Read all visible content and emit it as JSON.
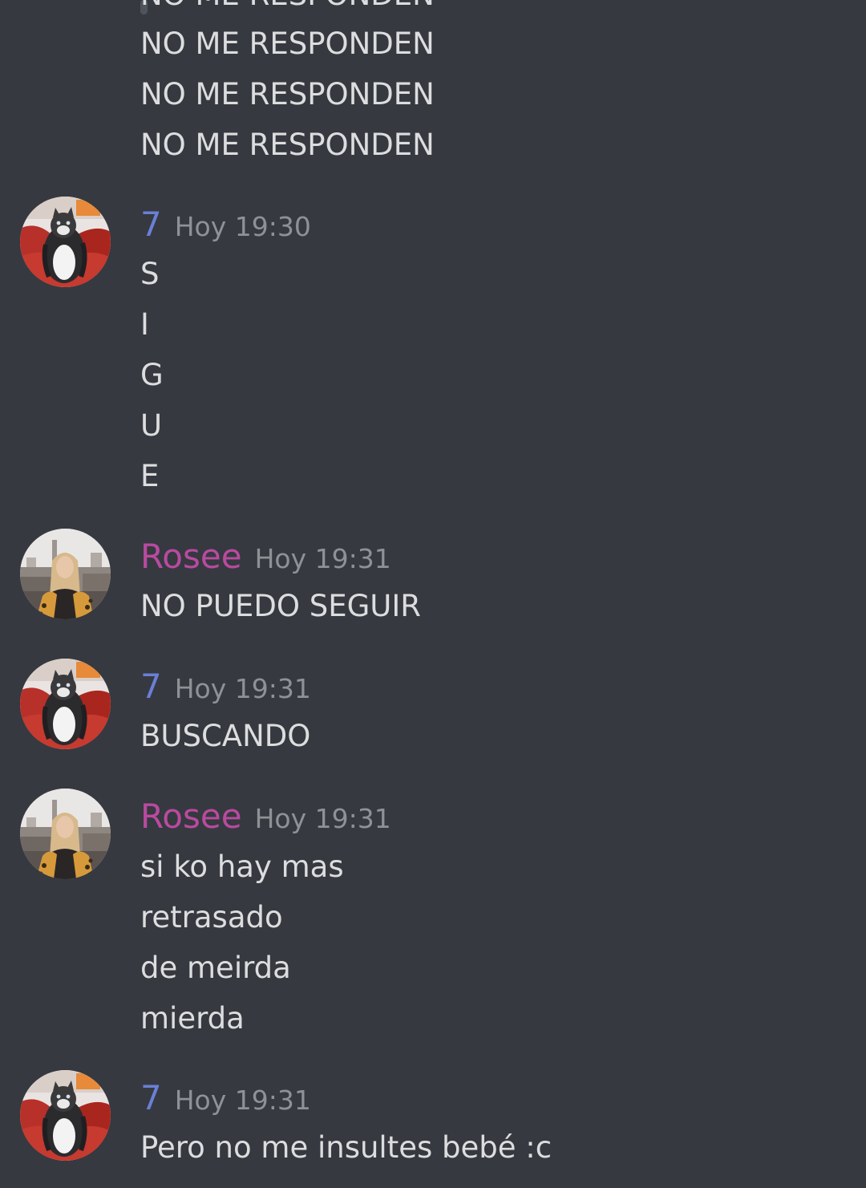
{
  "users": {
    "seven": {
      "name": "7",
      "color": "#6a7fd6",
      "avatar_icon": "cat-photo-avatar"
    },
    "rosee": {
      "name": "Rosee",
      "color": "#b94aa0",
      "avatar_icon": "woman-photo-avatar"
    }
  },
  "previous_messages": {
    "cutoff": "NO ME RESPONDEN",
    "lines": [
      "NO ME RESPONDEN",
      "NO ME RESPONDEN",
      "NO ME RESPONDEN"
    ]
  },
  "messages": [
    {
      "author": "7",
      "time": "Hoy 19:30",
      "lines": [
        "S",
        "I",
        "G",
        "U",
        "E"
      ]
    },
    {
      "author": "Rosee",
      "time": "Hoy 19:31",
      "lines": [
        "NO PUEDO SEGUIR"
      ]
    },
    {
      "author": "7",
      "time": "Hoy 19:31",
      "lines": [
        "BUSCANDO"
      ]
    },
    {
      "author": "Rosee",
      "time": "Hoy 19:31",
      "lines": [
        "si ko hay mas",
        "retrasado",
        "de meirda",
        "mierda"
      ]
    },
    {
      "author": "7",
      "time": "Hoy 19:31",
      "lines": [
        "Pero no me insultes bebé :c"
      ]
    }
  ]
}
